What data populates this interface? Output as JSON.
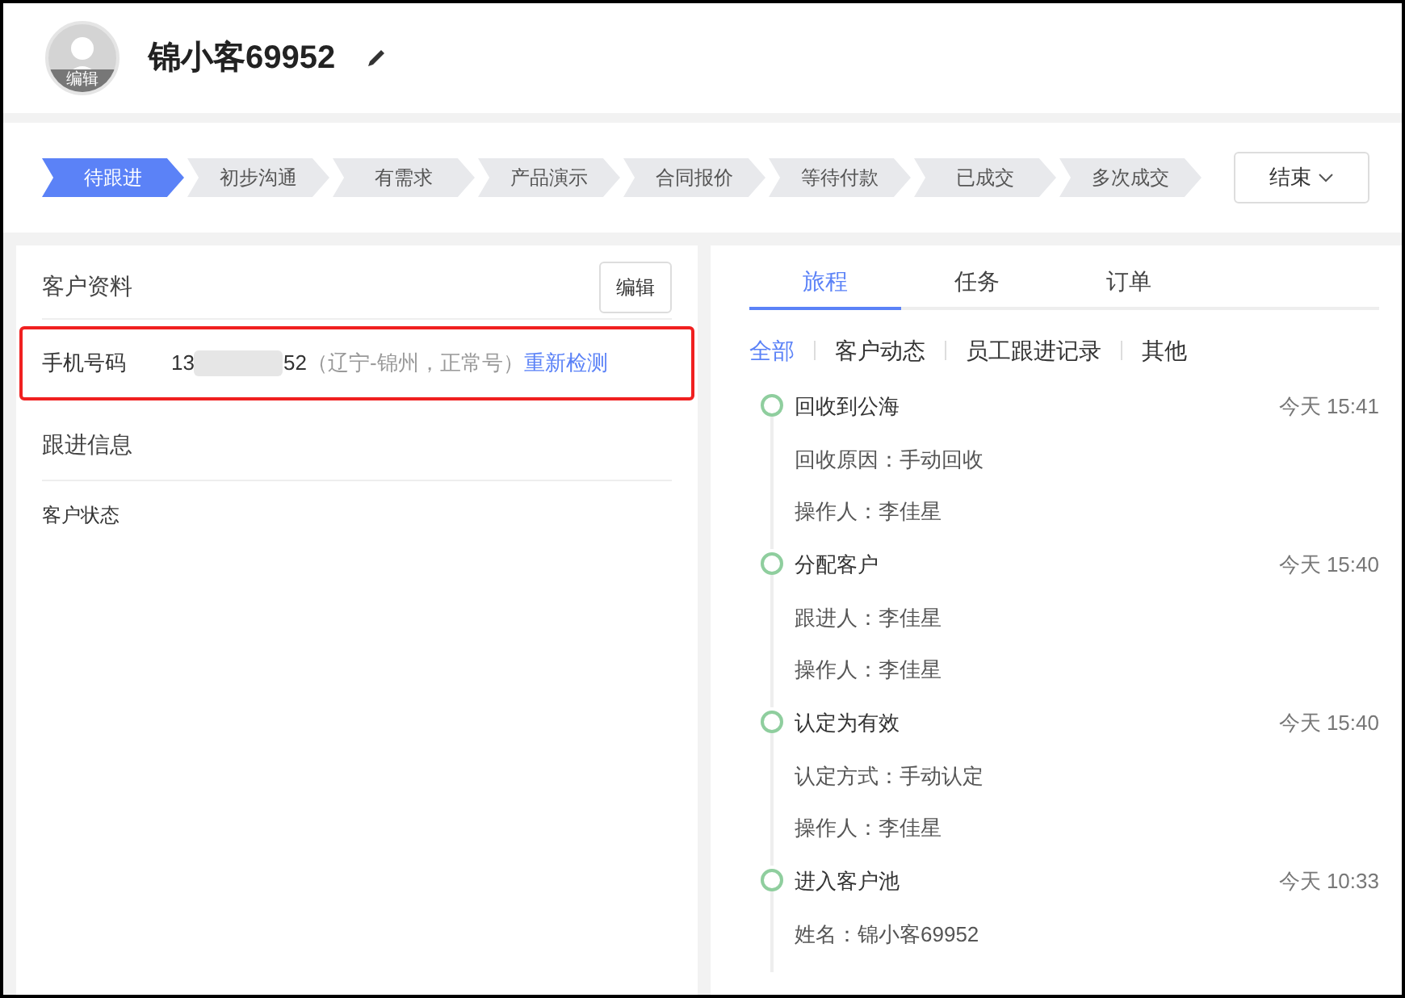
{
  "header": {
    "avatar_label": "编辑",
    "name": "锦小客69952"
  },
  "stages": [
    {
      "label": "待跟进",
      "selected": true
    },
    {
      "label": "初步沟通",
      "selected": false
    },
    {
      "label": "有需求",
      "selected": false
    },
    {
      "label": "产品演示",
      "selected": false
    },
    {
      "label": "合同报价",
      "selected": false
    },
    {
      "label": "等待付款",
      "selected": false
    },
    {
      "label": "已成交",
      "selected": false
    },
    {
      "label": "多次成交",
      "selected": false
    }
  ],
  "end_button": "结束",
  "customer_info": {
    "title": "客户资料",
    "edit_button": "编辑",
    "phone": {
      "label": "手机号码",
      "prefix": "13",
      "suffix": "52",
      "note": "（辽宁-锦州，正常号）",
      "recheck_link": "重新检测"
    }
  },
  "follow_info": {
    "title": "跟进信息",
    "fields": [
      "客户状态"
    ]
  },
  "tabs": [
    {
      "label": "旅程",
      "selected": true
    },
    {
      "label": "任务",
      "selected": false
    },
    {
      "label": "订单",
      "selected": false
    }
  ],
  "filters": [
    {
      "label": "全部",
      "selected": true
    },
    {
      "label": "客户动态",
      "selected": false
    },
    {
      "label": "员工跟进记录",
      "selected": false
    },
    {
      "label": "其他",
      "selected": false
    }
  ],
  "timeline": [
    {
      "title": "回收到公海",
      "time": "今天 15:41",
      "details": [
        "回收原因：手动回收",
        "操作人：李佳星"
      ]
    },
    {
      "title": "分配客户",
      "time": "今天 15:40",
      "details": [
        "跟进人：李佳星",
        "操作人：李佳星"
      ]
    },
    {
      "title": "认定为有效",
      "time": "今天 15:40",
      "details": [
        "认定方式：手动认定",
        "操作人：李佳星"
      ]
    },
    {
      "title": "进入客户池",
      "time": "今天 10:33",
      "details": [
        "姓名：锦小客69952"
      ]
    }
  ]
}
